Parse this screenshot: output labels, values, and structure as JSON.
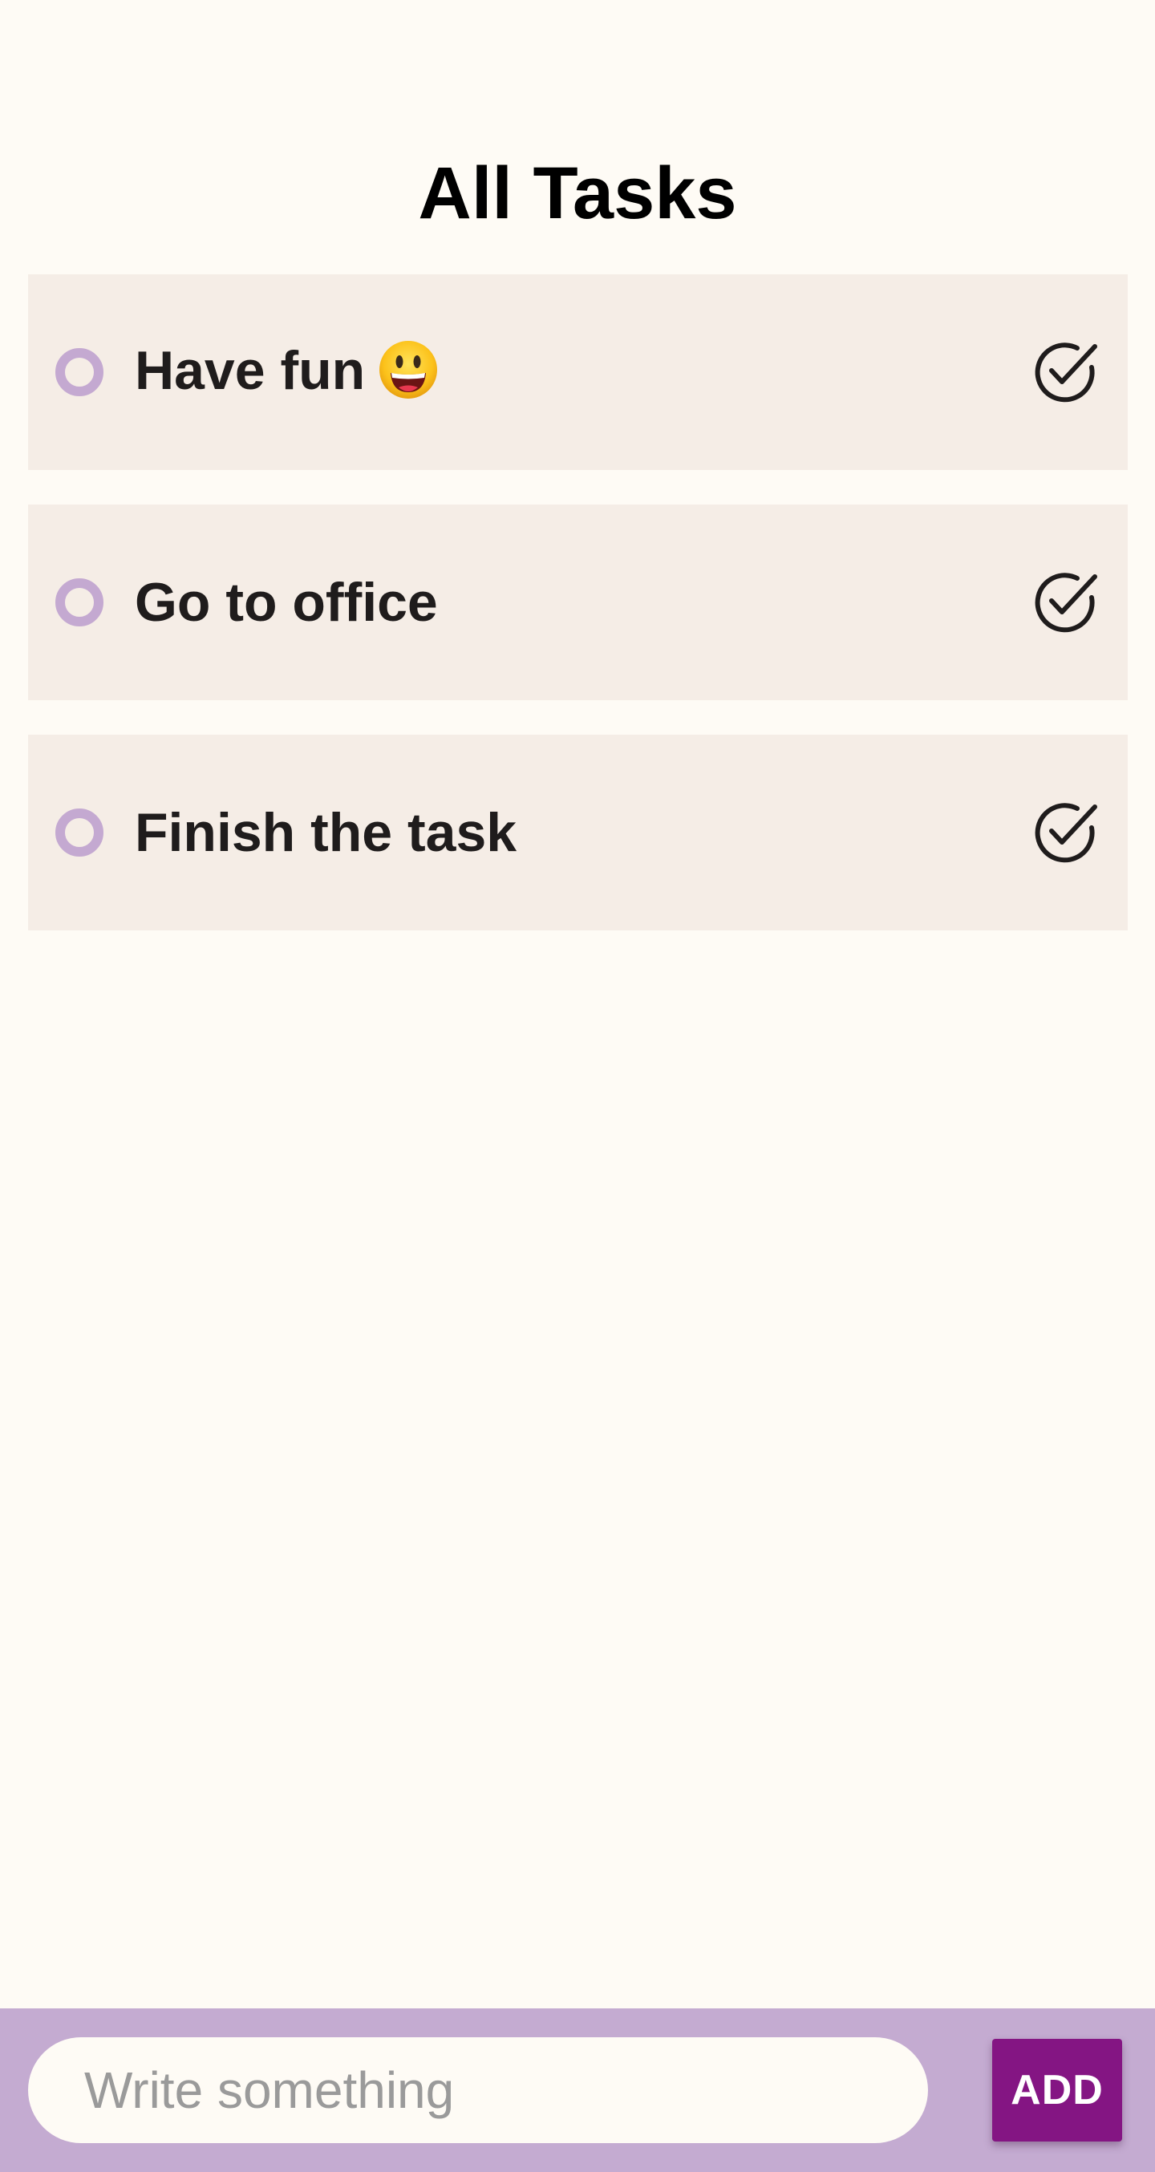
{
  "header": {
    "title": "All Tasks"
  },
  "tasks": [
    {
      "label": "Have fun",
      "emoji": "smiling-face-emoji"
    },
    {
      "label": "Go to office"
    },
    {
      "label": "Finish the task"
    }
  ],
  "icons": {
    "bullet": "circle-outline-icon",
    "complete": "check-circle-icon"
  },
  "input": {
    "placeholder": "Write something",
    "value": ""
  },
  "add_button": {
    "label": "ADD"
  },
  "colors": {
    "background": "#fefbf5",
    "card": "#f5ede6",
    "bullet": "#c4a9d1",
    "bottom_bar": "#c4abd1",
    "add_button": "#841583"
  }
}
